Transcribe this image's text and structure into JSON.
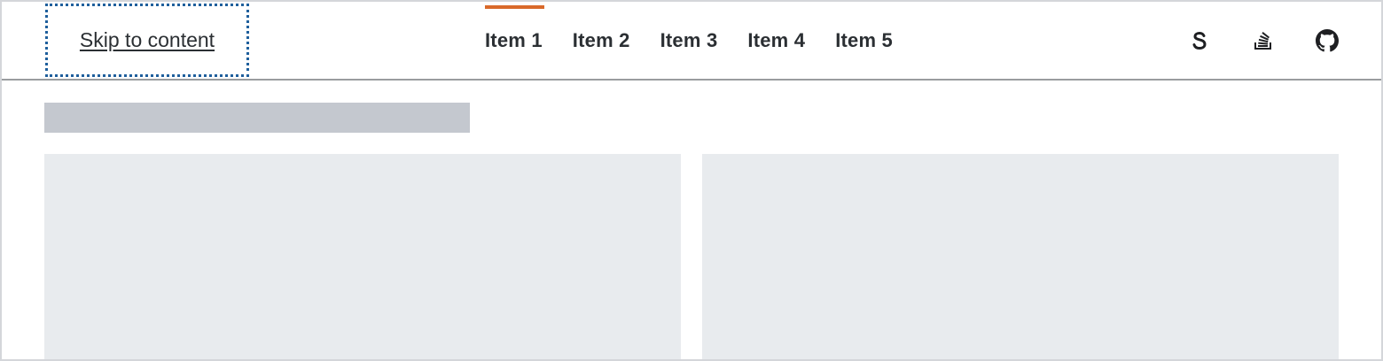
{
  "skip_link": {
    "label": "Skip to content"
  },
  "nav": {
    "items": [
      {
        "label": "Item 1",
        "active": true
      },
      {
        "label": "Item 2",
        "active": false
      },
      {
        "label": "Item 3",
        "active": false
      },
      {
        "label": "Item 4",
        "active": false
      },
      {
        "label": "Item 5",
        "active": false
      }
    ],
    "accent_color": "#d9692a"
  },
  "header_icons": [
    {
      "icon": "s-icon"
    },
    {
      "icon": "stack-overflow-icon"
    },
    {
      "icon": "github-icon"
    }
  ],
  "colors": {
    "focus_outline": "#1f5f9c",
    "text": "#2b2f33",
    "skeleton_title": "#c4c8cf",
    "skeleton_card": "#e8ebee"
  }
}
